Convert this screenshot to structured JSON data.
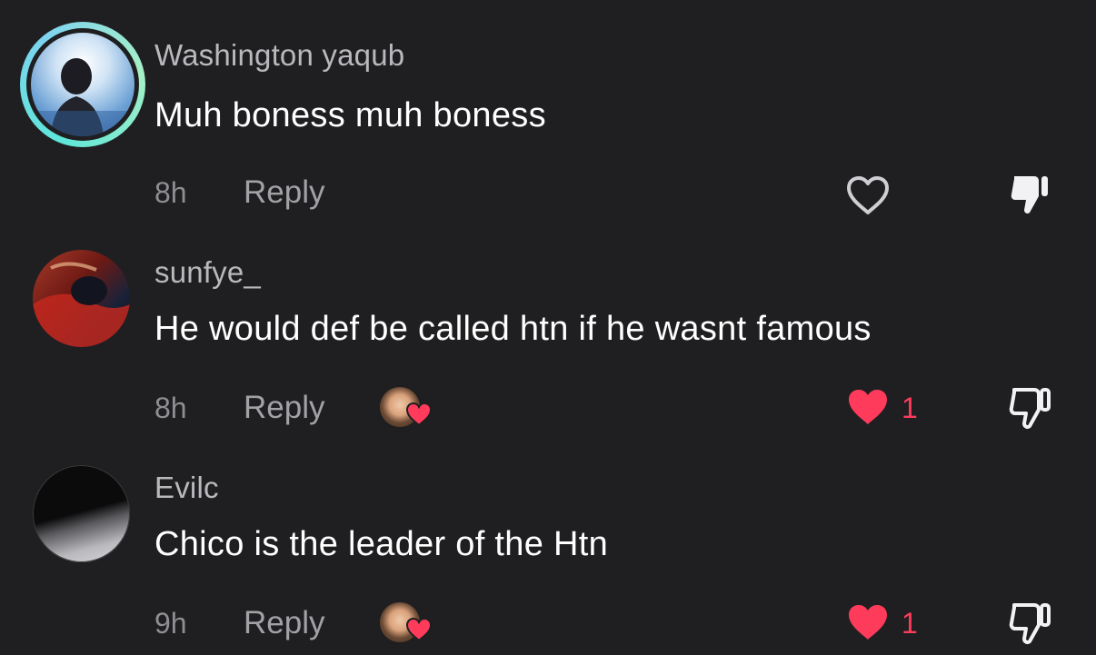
{
  "comments": [
    {
      "username": "Washington yaqub",
      "text": "Muh boness muh boness",
      "time": "8h",
      "reply_label": "Reply",
      "like_count": "",
      "liked": false,
      "creator_liked": false,
      "disliked": true
    },
    {
      "username": "sunfye_",
      "text": "He would def be called htn if he wasnt famous",
      "time": "8h",
      "reply_label": "Reply",
      "like_count": "1",
      "liked": true,
      "creator_liked": true,
      "disliked": false
    },
    {
      "username": "Evilc",
      "text": "Chico is the leader of the Htn",
      "time": "9h",
      "reply_label": "Reply",
      "like_count": "1",
      "liked": true,
      "creator_liked": true,
      "disliked": false
    }
  ],
  "colors": {
    "background": "#1f1f21",
    "like_red": "#ff3b5c",
    "secondary_text": "#a1a1a6",
    "ring_accent": "#5ee6d8"
  }
}
